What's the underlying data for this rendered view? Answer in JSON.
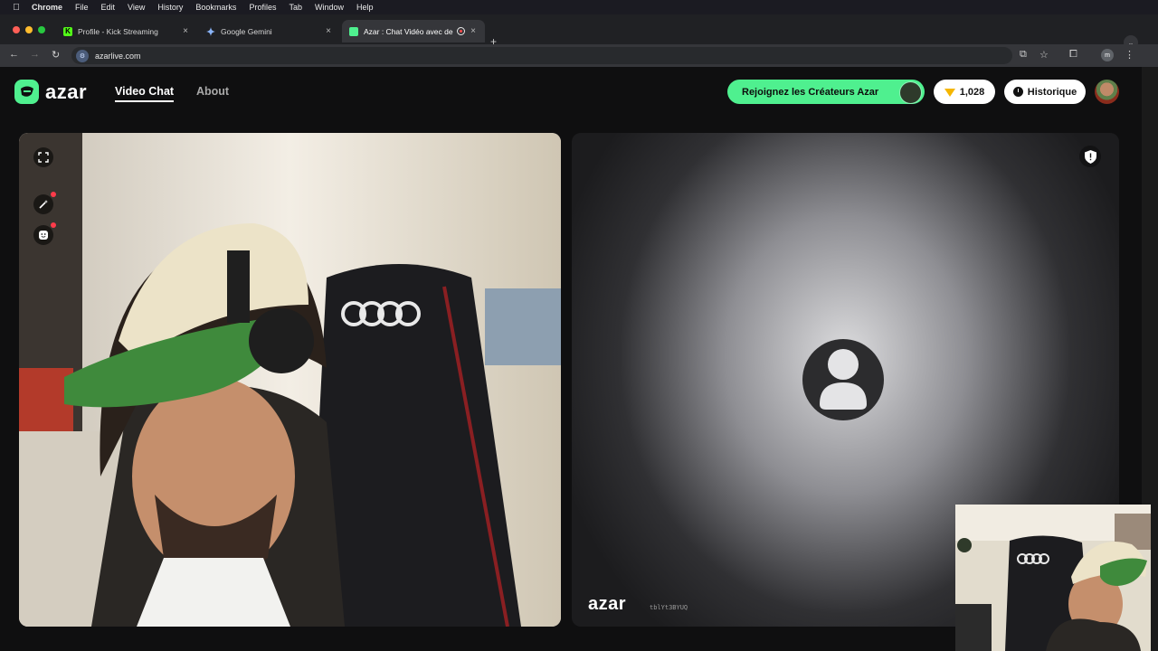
{
  "menubar": {
    "app": "Chrome",
    "items": [
      "File",
      "Edit",
      "View",
      "History",
      "Bookmarks",
      "Profiles",
      "Tab",
      "Window",
      "Help"
    ]
  },
  "tabs": [
    {
      "title": "Profile - Kick Streaming",
      "favicon": "K"
    },
    {
      "title": "Google Gemini",
      "favicon": "gemini-icon"
    },
    {
      "title": "Azar : Chat Vidéo avec de",
      "favicon": "azar-icon",
      "active": true
    }
  ],
  "address": {
    "url": "azarlive.com"
  },
  "site": {
    "logo_text": "azar",
    "nav": {
      "video_chat": "Video Chat",
      "about": "About"
    },
    "creators_button": "Rejoignez les Créateurs Azar",
    "gems_count": "1,028",
    "history_button": "Historique"
  },
  "remote": {
    "watermark": "azar",
    "session_code": "tblYt3BYUQ"
  },
  "colors": {
    "brand_green": "#4ff08f",
    "gem_gold": "#f5b600",
    "notify_red": "#ff3b4a"
  }
}
